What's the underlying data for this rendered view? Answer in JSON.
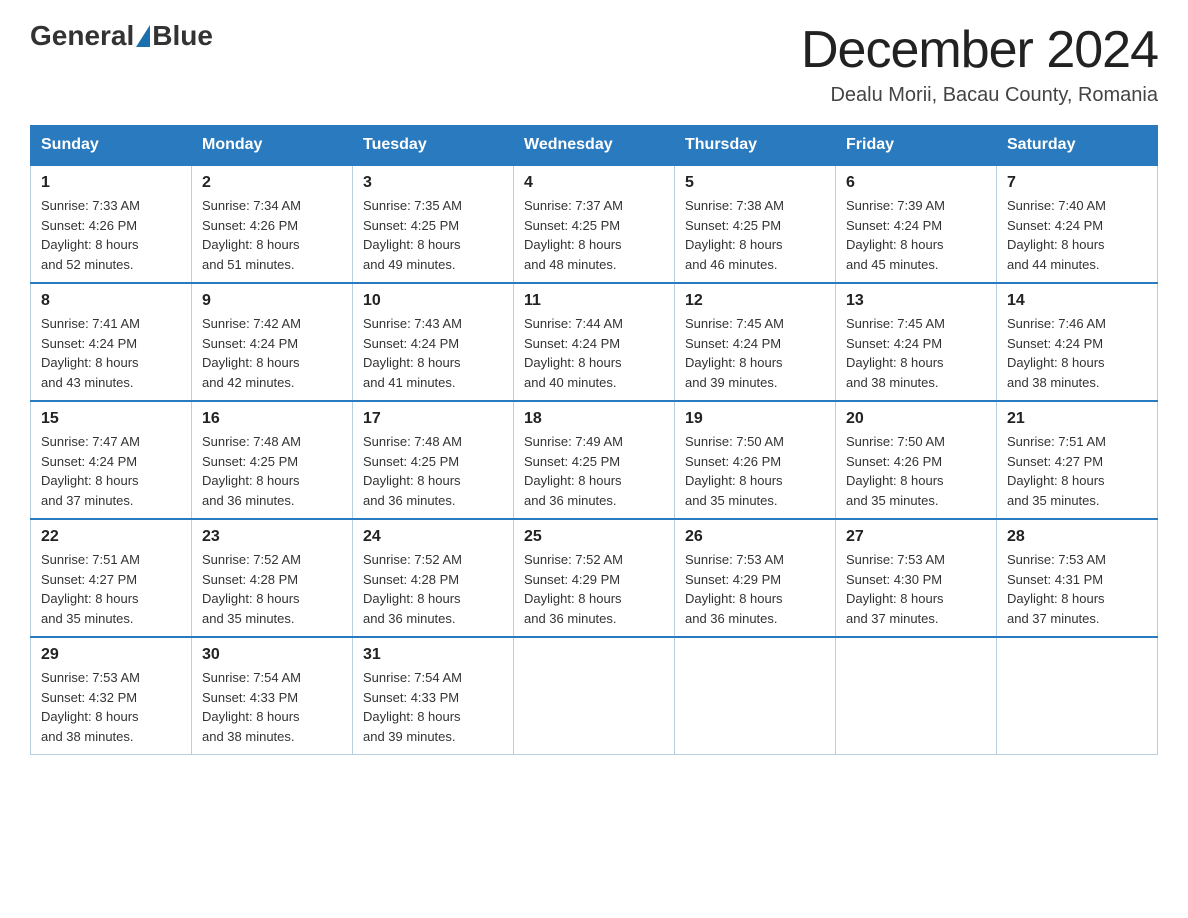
{
  "header": {
    "logo_general": "General",
    "logo_blue": "Blue",
    "main_title": "December 2024",
    "subtitle": "Dealu Morii, Bacau County, Romania"
  },
  "days_of_week": [
    "Sunday",
    "Monday",
    "Tuesday",
    "Wednesday",
    "Thursday",
    "Friday",
    "Saturday"
  ],
  "weeks": [
    [
      {
        "day": "1",
        "sunrise": "7:33 AM",
        "sunset": "4:26 PM",
        "daylight": "8 hours and 52 minutes."
      },
      {
        "day": "2",
        "sunrise": "7:34 AM",
        "sunset": "4:26 PM",
        "daylight": "8 hours and 51 minutes."
      },
      {
        "day": "3",
        "sunrise": "7:35 AM",
        "sunset": "4:25 PM",
        "daylight": "8 hours and 49 minutes."
      },
      {
        "day": "4",
        "sunrise": "7:37 AM",
        "sunset": "4:25 PM",
        "daylight": "8 hours and 48 minutes."
      },
      {
        "day": "5",
        "sunrise": "7:38 AM",
        "sunset": "4:25 PM",
        "daylight": "8 hours and 46 minutes."
      },
      {
        "day": "6",
        "sunrise": "7:39 AM",
        "sunset": "4:24 PM",
        "daylight": "8 hours and 45 minutes."
      },
      {
        "day": "7",
        "sunrise": "7:40 AM",
        "sunset": "4:24 PM",
        "daylight": "8 hours and 44 minutes."
      }
    ],
    [
      {
        "day": "8",
        "sunrise": "7:41 AM",
        "sunset": "4:24 PM",
        "daylight": "8 hours and 43 minutes."
      },
      {
        "day": "9",
        "sunrise": "7:42 AM",
        "sunset": "4:24 PM",
        "daylight": "8 hours and 42 minutes."
      },
      {
        "day": "10",
        "sunrise": "7:43 AM",
        "sunset": "4:24 PM",
        "daylight": "8 hours and 41 minutes."
      },
      {
        "day": "11",
        "sunrise": "7:44 AM",
        "sunset": "4:24 PM",
        "daylight": "8 hours and 40 minutes."
      },
      {
        "day": "12",
        "sunrise": "7:45 AM",
        "sunset": "4:24 PM",
        "daylight": "8 hours and 39 minutes."
      },
      {
        "day": "13",
        "sunrise": "7:45 AM",
        "sunset": "4:24 PM",
        "daylight": "8 hours and 38 minutes."
      },
      {
        "day": "14",
        "sunrise": "7:46 AM",
        "sunset": "4:24 PM",
        "daylight": "8 hours and 38 minutes."
      }
    ],
    [
      {
        "day": "15",
        "sunrise": "7:47 AM",
        "sunset": "4:24 PM",
        "daylight": "8 hours and 37 minutes."
      },
      {
        "day": "16",
        "sunrise": "7:48 AM",
        "sunset": "4:25 PM",
        "daylight": "8 hours and 36 minutes."
      },
      {
        "day": "17",
        "sunrise": "7:48 AM",
        "sunset": "4:25 PM",
        "daylight": "8 hours and 36 minutes."
      },
      {
        "day": "18",
        "sunrise": "7:49 AM",
        "sunset": "4:25 PM",
        "daylight": "8 hours and 36 minutes."
      },
      {
        "day": "19",
        "sunrise": "7:50 AM",
        "sunset": "4:26 PM",
        "daylight": "8 hours and 35 minutes."
      },
      {
        "day": "20",
        "sunrise": "7:50 AM",
        "sunset": "4:26 PM",
        "daylight": "8 hours and 35 minutes."
      },
      {
        "day": "21",
        "sunrise": "7:51 AM",
        "sunset": "4:27 PM",
        "daylight": "8 hours and 35 minutes."
      }
    ],
    [
      {
        "day": "22",
        "sunrise": "7:51 AM",
        "sunset": "4:27 PM",
        "daylight": "8 hours and 35 minutes."
      },
      {
        "day": "23",
        "sunrise": "7:52 AM",
        "sunset": "4:28 PM",
        "daylight": "8 hours and 35 minutes."
      },
      {
        "day": "24",
        "sunrise": "7:52 AM",
        "sunset": "4:28 PM",
        "daylight": "8 hours and 36 minutes."
      },
      {
        "day": "25",
        "sunrise": "7:52 AM",
        "sunset": "4:29 PM",
        "daylight": "8 hours and 36 minutes."
      },
      {
        "day": "26",
        "sunrise": "7:53 AM",
        "sunset": "4:29 PM",
        "daylight": "8 hours and 36 minutes."
      },
      {
        "day": "27",
        "sunrise": "7:53 AM",
        "sunset": "4:30 PM",
        "daylight": "8 hours and 37 minutes."
      },
      {
        "day": "28",
        "sunrise": "7:53 AM",
        "sunset": "4:31 PM",
        "daylight": "8 hours and 37 minutes."
      }
    ],
    [
      {
        "day": "29",
        "sunrise": "7:53 AM",
        "sunset": "4:32 PM",
        "daylight": "8 hours and 38 minutes."
      },
      {
        "day": "30",
        "sunrise": "7:54 AM",
        "sunset": "4:33 PM",
        "daylight": "8 hours and 38 minutes."
      },
      {
        "day": "31",
        "sunrise": "7:54 AM",
        "sunset": "4:33 PM",
        "daylight": "8 hours and 39 minutes."
      },
      null,
      null,
      null,
      null
    ]
  ],
  "labels": {
    "sunrise": "Sunrise:",
    "sunset": "Sunset:",
    "daylight": "Daylight:"
  }
}
